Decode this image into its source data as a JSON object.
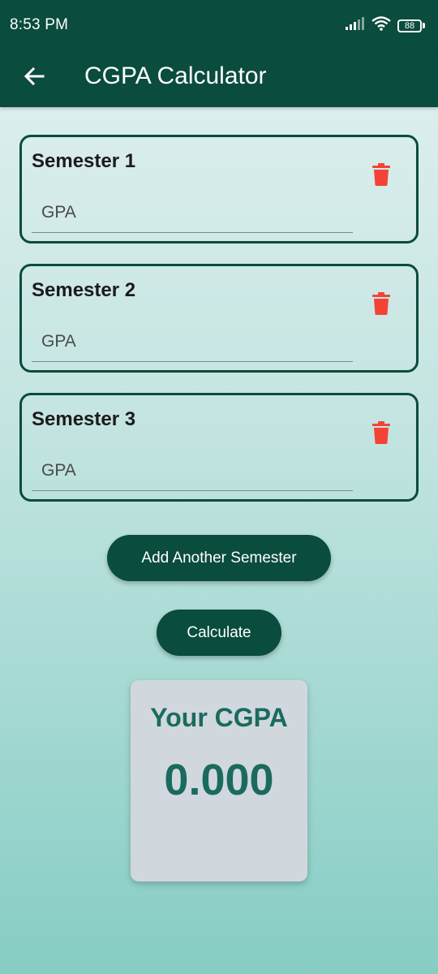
{
  "status_bar": {
    "time": "8:53 PM",
    "battery_level": "88",
    "icons": [
      "signal-icon",
      "wifi-icon",
      "battery-icon"
    ]
  },
  "app_bar": {
    "title": "CGPA Calculator",
    "back_icon": "arrow-left-icon"
  },
  "semesters": [
    {
      "label": "Semester 1",
      "gpa_placeholder": "GPA",
      "gpa_value": ""
    },
    {
      "label": "Semester 2",
      "gpa_placeholder": "GPA",
      "gpa_value": ""
    },
    {
      "label": "Semester 3",
      "gpa_placeholder": "GPA",
      "gpa_value": ""
    }
  ],
  "actions": {
    "add_label": "Add Another Semester",
    "calculate_label": "Calculate"
  },
  "result": {
    "label": "Your CGPA",
    "value": "0.000"
  },
  "colors": {
    "primary": "#0a4c3e",
    "delete": "#f44336",
    "accent_text": "#1a6b5e",
    "result_card": "#d0d8de"
  }
}
